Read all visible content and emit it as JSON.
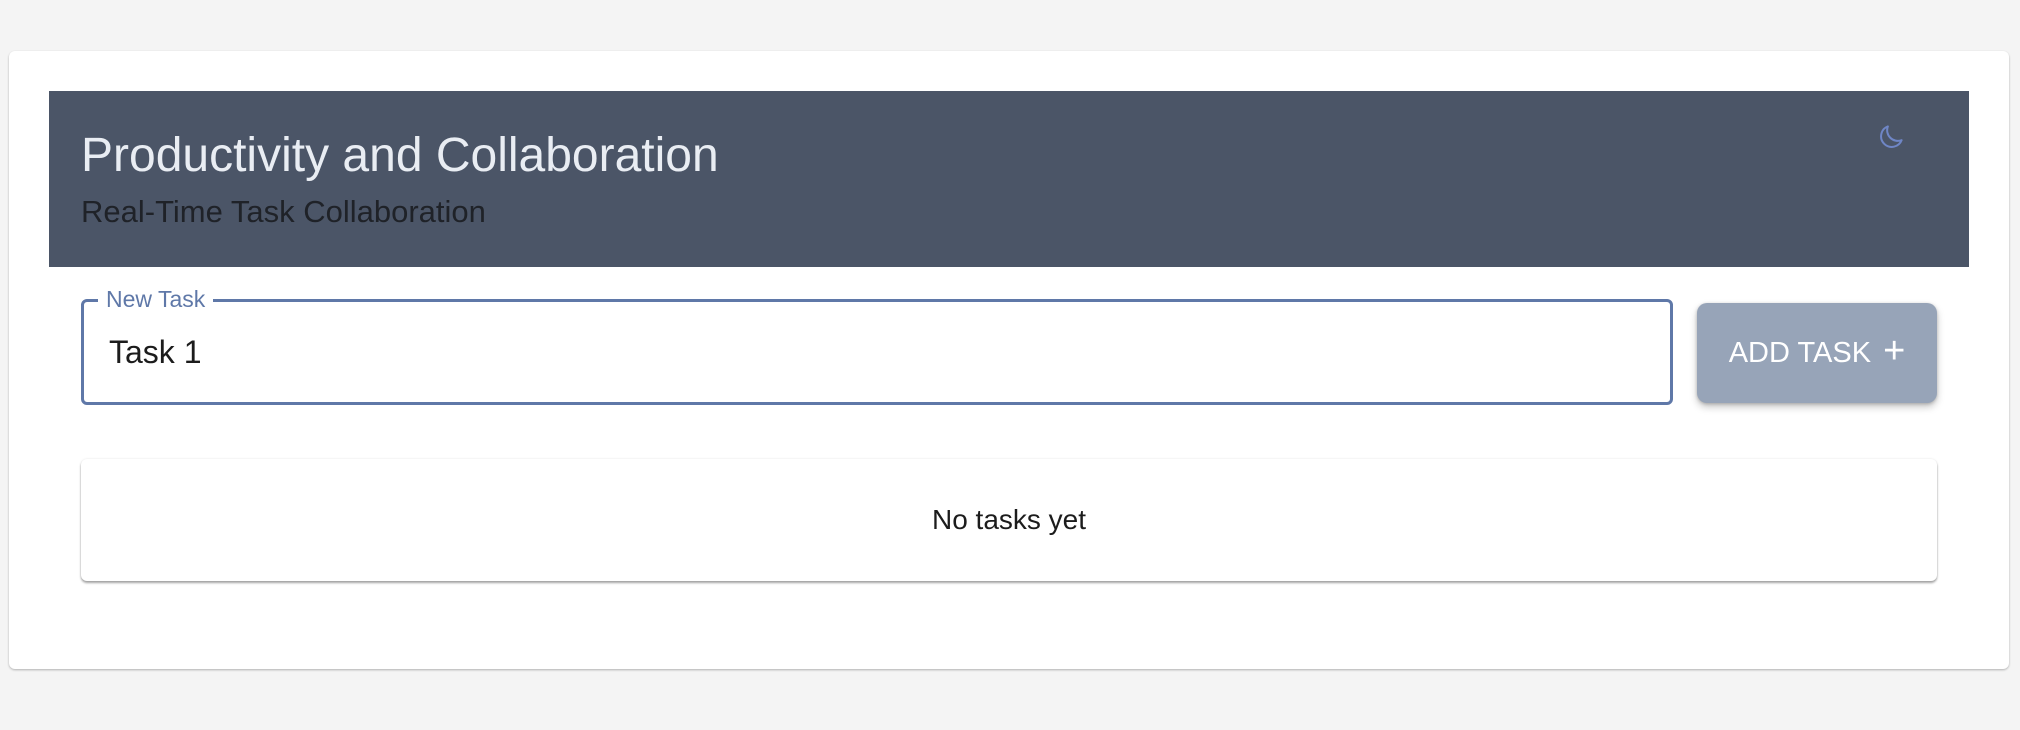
{
  "header": {
    "title": "Productivity and Collaboration",
    "subtitle": "Real-Time Task Collaboration",
    "theme_toggle_icon": "moon-icon"
  },
  "task_form": {
    "label": "New Task",
    "value": "Task 1",
    "add_button_label": "ADD TASK",
    "add_button_icon": "plus-icon"
  },
  "tasks": {
    "items": [],
    "empty_message": "No tasks yet"
  },
  "colors": {
    "header_background": "#4b5567",
    "accent": "#5f78a8",
    "button_background": "#97a4b8",
    "page_background": "#f4f4f4"
  }
}
